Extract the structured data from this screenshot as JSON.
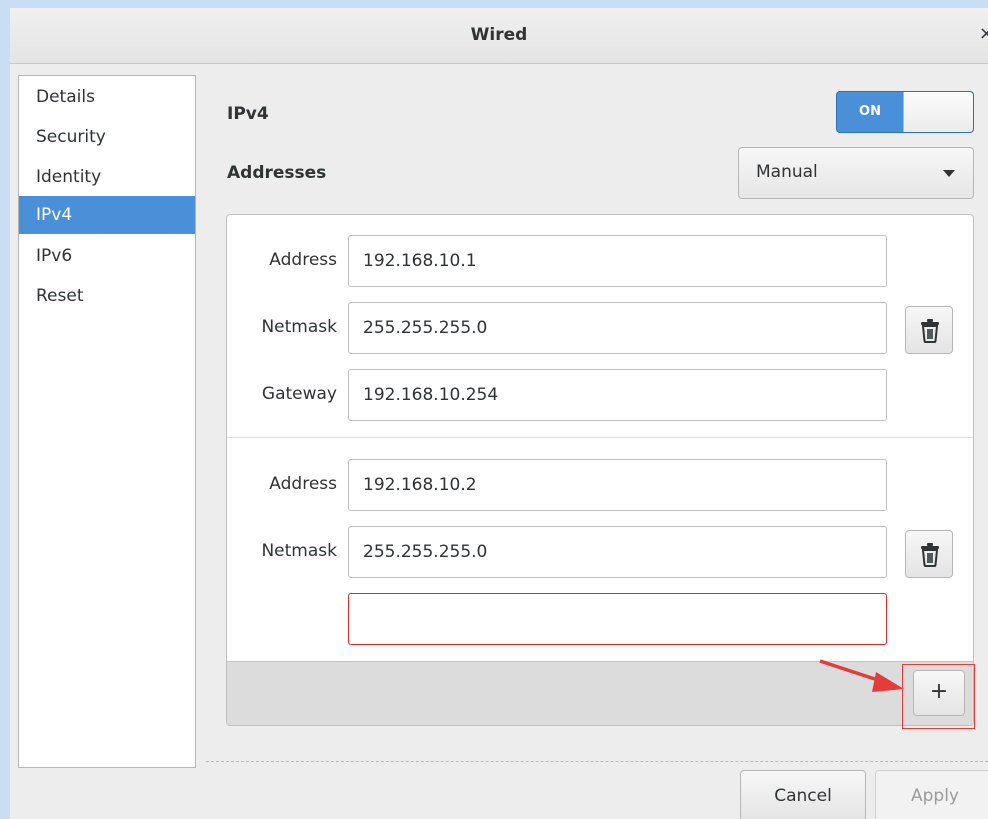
{
  "window": {
    "title": "Wired",
    "close_glyph": "×"
  },
  "sidebar": {
    "items": [
      {
        "label": "Details",
        "selected": false
      },
      {
        "label": "Security",
        "selected": false
      },
      {
        "label": "Identity",
        "selected": false
      },
      {
        "label": "IPv4",
        "selected": true
      },
      {
        "label": "IPv6",
        "selected": false
      },
      {
        "label": "Reset",
        "selected": false
      }
    ]
  },
  "ipv4": {
    "heading": "IPv4",
    "toggle_label": "ON",
    "addresses_label": "Addresses",
    "method_value": "Manual"
  },
  "entries": [
    {
      "address_label": "Address",
      "address_value": "192.168.10.1",
      "netmask_label": "Netmask",
      "netmask_value": "255.255.255.0",
      "gateway_label": "Gateway",
      "gateway_value": "192.168.10.254"
    },
    {
      "address_label": "Address",
      "address_value": "192.168.10.2",
      "netmask_label": "Netmask",
      "netmask_value": "255.255.255.0",
      "gateway_value": ""
    }
  ],
  "add_button_label": "+",
  "footer": {
    "cancel_label": "Cancel",
    "apply_label": "Apply"
  },
  "colors": {
    "accent": "#4a90d9",
    "annotation": "#e43b3b",
    "error_border": "#d03030"
  }
}
